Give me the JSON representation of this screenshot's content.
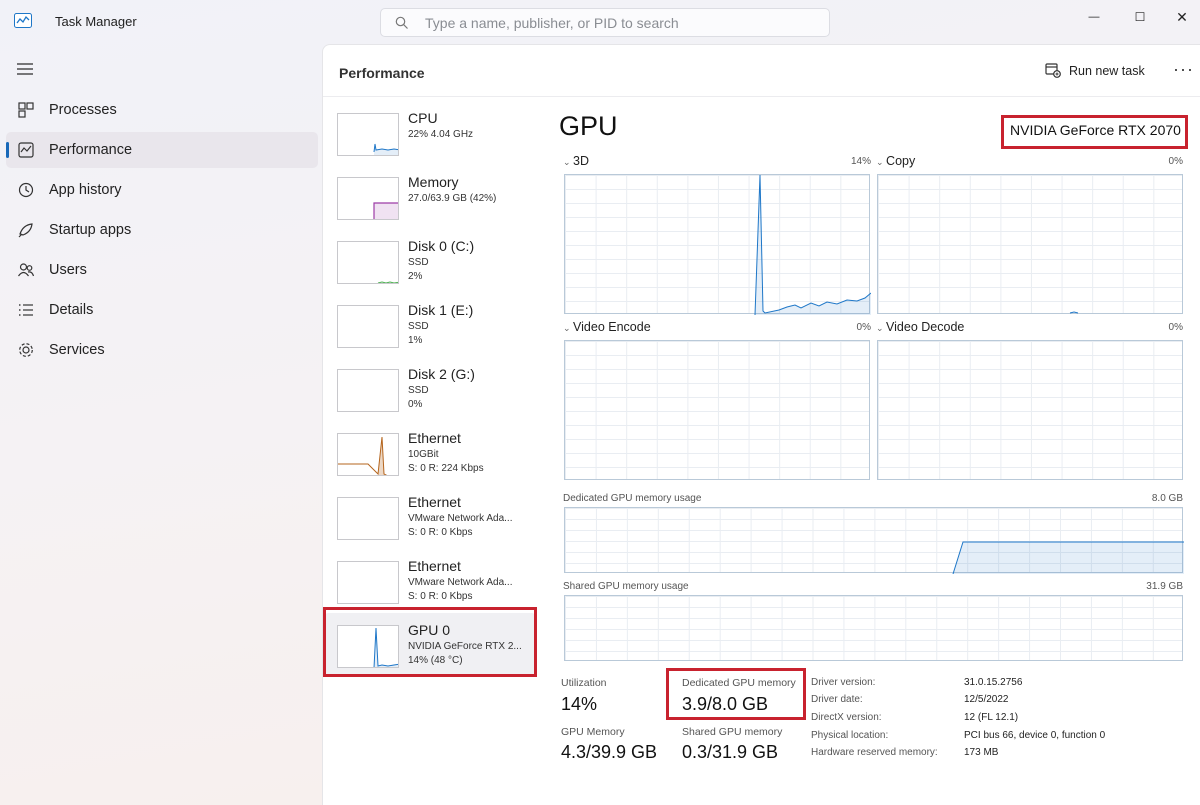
{
  "app": {
    "title": "Task Manager",
    "icon": "task-manager-icon"
  },
  "search": {
    "placeholder": "Type a name, publisher, or PID to search"
  },
  "window_controls": {
    "minimize": "—",
    "maximize": "☐",
    "close": "✕"
  },
  "nav": [
    {
      "label": "Processes",
      "icon": "processes-icon"
    },
    {
      "label": "Performance",
      "icon": "performance-icon",
      "active": true
    },
    {
      "label": "App history",
      "icon": "app-history-icon"
    },
    {
      "label": "Startup apps",
      "icon": "startup-apps-icon"
    },
    {
      "label": "Users",
      "icon": "users-icon"
    },
    {
      "label": "Details",
      "icon": "details-icon"
    },
    {
      "label": "Services",
      "icon": "services-icon"
    }
  ],
  "header": {
    "title": "Performance",
    "run_new_task": "Run new task",
    "more": "···"
  },
  "devices": [
    {
      "name": "CPU",
      "lines": [
        "22%  4.04 GHz"
      ],
      "color": "#1e77c8"
    },
    {
      "name": "Memory",
      "lines": [
        "27.0/63.9 GB (42%)"
      ],
      "color": "#9c3ca6"
    },
    {
      "name": "Disk 0 (C:)",
      "lines": [
        "SSD",
        "2%"
      ],
      "color": "#4caf50"
    },
    {
      "name": "Disk 1 (E:)",
      "lines": [
        "SSD",
        "1%"
      ],
      "color": "#4caf50"
    },
    {
      "name": "Disk 2 (G:)",
      "lines": [
        "SSD",
        "0%"
      ],
      "color": "#4caf50"
    },
    {
      "name": "Ethernet",
      "lines": [
        "10GBit",
        "S: 0  R: 224 Kbps"
      ],
      "color": "#b5651d"
    },
    {
      "name": "Ethernet",
      "lines": [
        "VMware Network Ada...",
        "S: 0  R: 0 Kbps"
      ],
      "color": "#b5651d"
    },
    {
      "name": "Ethernet",
      "lines": [
        "VMware Network Ada...",
        "S: 0  R: 0 Kbps"
      ],
      "color": "#b5651d"
    },
    {
      "name": "GPU 0",
      "lines": [
        "NVIDIA GeForce RTX 2...",
        "14%  (48 °C)"
      ],
      "color": "#1e77c8",
      "selected": true
    }
  ],
  "gpu": {
    "title": "GPU",
    "model": "NVIDIA GeForce RTX 2070",
    "engines": [
      {
        "name": "3D",
        "pct": "14%"
      },
      {
        "name": "Copy",
        "pct": "0%"
      },
      {
        "name": "Video Encode",
        "pct": "0%"
      },
      {
        "name": "Video Decode",
        "pct": "0%"
      }
    ],
    "dedicated_label": "Dedicated GPU memory usage",
    "dedicated_max": "8.0 GB",
    "shared_label": "Shared GPU memory usage",
    "shared_max": "31.9 GB",
    "stats": {
      "utilization": {
        "label": "Utilization",
        "value": "14%"
      },
      "dedicated": {
        "label": "Dedicated GPU memory",
        "value": "3.9/8.0 GB"
      },
      "gpu_memory": {
        "label": "GPU Memory",
        "value": "4.3/39.9 GB"
      },
      "shared": {
        "label": "Shared GPU memory",
        "value": "0.3/31.9 GB"
      }
    },
    "info": [
      {
        "k": "Driver version:",
        "v": "31.0.15.2756"
      },
      {
        "k": "Driver date:",
        "v": "12/5/2022"
      },
      {
        "k": "DirectX version:",
        "v": "12 (FL 12.1)"
      },
      {
        "k": "Physical location:",
        "v": "PCI bus 66, device 0, function 0"
      },
      {
        "k": "Hardware reserved memory:",
        "v": "173 MB"
      }
    ]
  },
  "accent_colors": {
    "graph_line": "#1e77c8",
    "highlight": "#c8222e",
    "nav_indicator": "#1868b8"
  }
}
